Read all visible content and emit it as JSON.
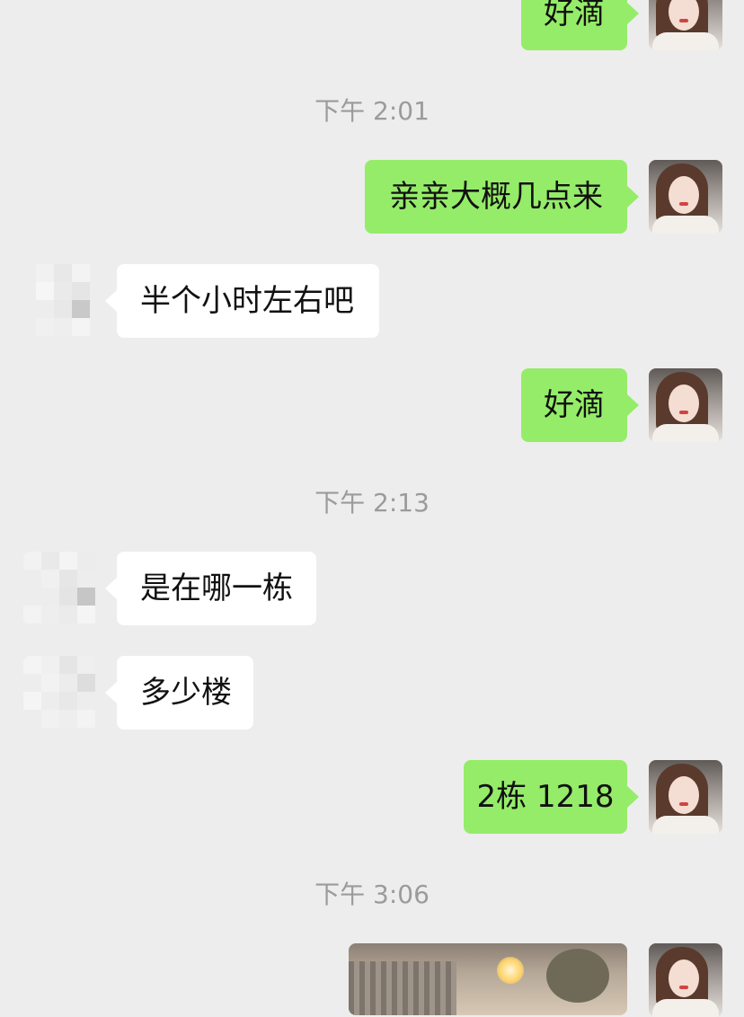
{
  "messages": {
    "m0_text": "好滴",
    "t1_time": "下午 2:01",
    "m1_text": "亲亲大概几点来",
    "m2_text": "半个小时左右吧",
    "m3_text": "好滴",
    "t2_time": "下午 2:13",
    "m4_text": "是在哪一栋",
    "m5_text": "多少楼",
    "m6_text": "2栋 1218",
    "t3_time": "下午 3:06"
  },
  "colors": {
    "background": "#ededed",
    "outgoing_bubble": "#95ec69",
    "incoming_bubble": "#ffffff",
    "timestamp_text": "#9b9b9b",
    "message_text": "#111111"
  },
  "icons": {
    "self_avatar": "user-avatar-photo",
    "contact_avatar": "blurred-avatar-icon",
    "photo_message": "photo-thumbnail"
  }
}
